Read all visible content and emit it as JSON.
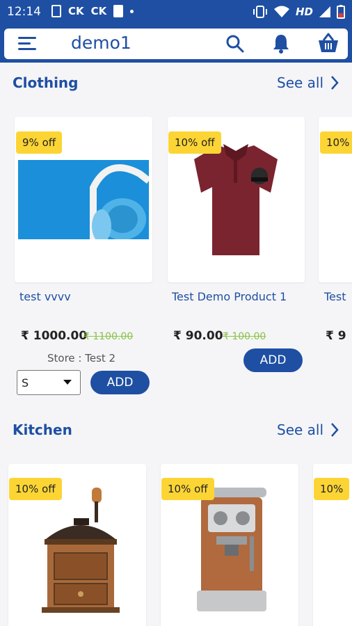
{
  "status_bar": {
    "time": "12:14",
    "carrier1": "CK",
    "carrier2": "CK",
    "network": "HD"
  },
  "app_bar": {
    "title": "demo1"
  },
  "sections": [
    {
      "title": "Clothing",
      "see_all": "See all",
      "products": [
        {
          "badge": "9% off",
          "name": "test vvvv",
          "price": "₹ 1000.00",
          "old_price": "₹ 1100.00",
          "store": "Store : Test 2",
          "select_value": "S",
          "add_label": "ADD"
        },
        {
          "badge": "10% off",
          "name": "Test Demo Product 1",
          "price": "₹ 90.00",
          "old_price": "₹ 100.00",
          "add_label": "ADD"
        },
        {
          "badge": "10%",
          "name": "Test",
          "price": "₹ 9"
        }
      ]
    },
    {
      "title": "Kitchen",
      "see_all": "See all",
      "products": [
        {
          "badge": "10% off"
        },
        {
          "badge": "10% off"
        },
        {
          "badge": "10%"
        }
      ]
    }
  ],
  "colors": {
    "primary": "#1e4fa3",
    "badge": "#fcd535",
    "strike_price": "#8bc34a",
    "background": "#f5f5f7"
  },
  "icons": [
    "hamburger-menu-icon",
    "search-icon",
    "bell-icon",
    "shopping-basket-icon",
    "chevron-right-icon",
    "caret-down-icon"
  ]
}
